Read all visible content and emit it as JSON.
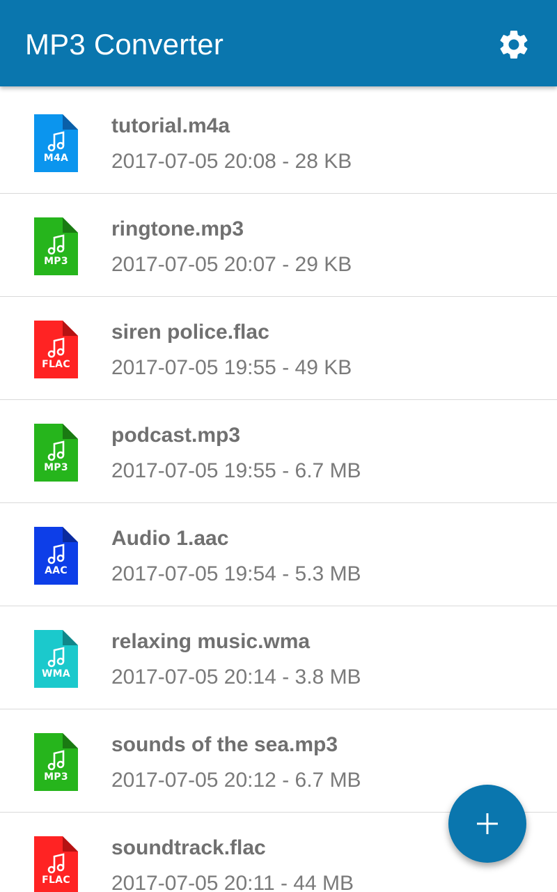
{
  "app": {
    "title": "MP3 Converter",
    "accent_color": "#0a76ae"
  },
  "toolbar": {
    "settings_icon": "gear-icon"
  },
  "files": [
    {
      "name": "tutorial.m4a",
      "meta": "2017-07-05 20:08 - 28 KB",
      "ext": "M4A",
      "color": "#0b95ee",
      "fold": "#0a5fa8",
      "icon": "music-note-icon"
    },
    {
      "name": "ringtone.mp3",
      "meta": "2017-07-05 20:07 - 29 KB",
      "ext": "MP3",
      "color": "#26b51c",
      "fold": "#1a7a12",
      "icon": "music-note-icon"
    },
    {
      "name": "siren police.flac",
      "meta": "2017-07-05 19:55 - 49 KB",
      "ext": "FLAC",
      "color": "#ff2323",
      "fold": "#b51212",
      "icon": "music-note-icon"
    },
    {
      "name": "podcast.mp3",
      "meta": "2017-07-05 19:55 - 6.7 MB",
      "ext": "MP3",
      "color": "#26b51c",
      "fold": "#1a7a12",
      "icon": "music-note-icon"
    },
    {
      "name": "Audio 1.aac",
      "meta": "2017-07-05 19:54 - 5.3 MB",
      "ext": "AAC",
      "color": "#0d3ee8",
      "fold": "#0a2a9e",
      "icon": "music-note-icon"
    },
    {
      "name": "relaxing music.wma",
      "meta": "2017-07-05 20:14 - 3.8 MB",
      "ext": "WMA",
      "color": "#1bc9cc",
      "fold": "#10878a",
      "icon": "music-note-icon"
    },
    {
      "name": "sounds of the sea.mp3",
      "meta": "2017-07-05 20:12 - 6.7 MB",
      "ext": "MP3",
      "color": "#26b51c",
      "fold": "#1a7a12",
      "icon": "music-note-icon"
    },
    {
      "name": "soundtrack.flac",
      "meta": "2017-07-05 20:11 - 44 MB",
      "ext": "FLAC",
      "color": "#ff2323",
      "fold": "#b51212",
      "icon": "music-note-icon"
    }
  ],
  "fab": {
    "icon": "plus-icon"
  }
}
